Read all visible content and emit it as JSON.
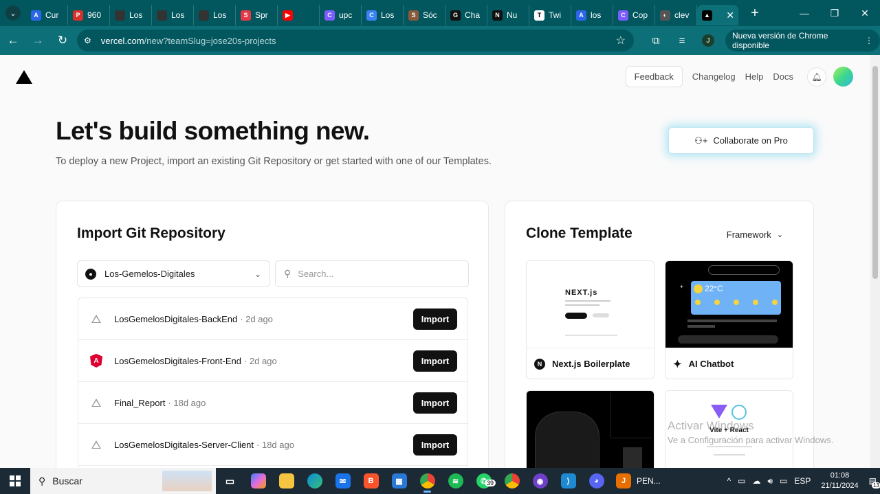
{
  "browser": {
    "tabs": [
      {
        "label": "Cur",
        "icon": "A",
        "color": "#2b66e8"
      },
      {
        "label": "960",
        "icon": "P",
        "color": "#d9302c"
      },
      {
        "label": "Los",
        "icon": "",
        "color": "#333333"
      },
      {
        "label": "Los",
        "icon": "",
        "color": "#333333"
      },
      {
        "label": "Los",
        "icon": "",
        "color": "#333333"
      },
      {
        "label": "Spr",
        "icon": "S",
        "color": "#e63946"
      },
      {
        "label": "",
        "icon": "▶",
        "color": "#ff0000"
      },
      {
        "label": "upc",
        "icon": "C",
        "color": "#7b5cff"
      },
      {
        "label": "Los",
        "icon": "C",
        "color": "#3b82f6"
      },
      {
        "label": "Sóc",
        "icon": "S",
        "color": "#8a5a3c"
      },
      {
        "label": "Cha",
        "icon": "G",
        "color": "#111111"
      },
      {
        "label": "Nu",
        "icon": "N",
        "color": "#111111"
      },
      {
        "label": "Twi",
        "icon": "T",
        "color": "#ffffff"
      },
      {
        "label": "los",
        "icon": "A",
        "color": "#2b66e8"
      },
      {
        "label": "Cop",
        "icon": "C",
        "color": "#7b5cff"
      },
      {
        "label": "clev",
        "icon": "◐",
        "color": "#555555"
      }
    ],
    "active_tab_close": "✕",
    "new_tab": "+",
    "url_host": "vercel.com",
    "url_path": "/new?teamSlug=jose20s-projects",
    "profile_initial": "J",
    "update_label": "Nueva versión de Chrome disponible"
  },
  "header": {
    "feedback": "Feedback",
    "changelog": "Changelog",
    "help": "Help",
    "docs": "Docs"
  },
  "hero": {
    "title": "Let's build something new.",
    "subtitle": "To deploy a new Project, import an existing Git Repository or get started with one of our Templates.",
    "collab_button": "Collaborate on Pro"
  },
  "import": {
    "title": "Import Git Repository",
    "account": "Los-Gemelos-Digitales",
    "search_placeholder": "Search...",
    "import_label": "Import",
    "repos": [
      {
        "name": "LosGemelosDigitales-BackEnd",
        "age": "· 2d ago",
        "icon": "triangle"
      },
      {
        "name": "LosGemelosDigitales-Front-End",
        "age": "· 2d ago",
        "icon": "angular"
      },
      {
        "name": "Final_Report",
        "age": "· 18d ago",
        "icon": "triangle"
      },
      {
        "name": "LosGemelosDigitales-Server-Client",
        "age": "· 18d ago",
        "icon": "triangle"
      }
    ]
  },
  "templates": {
    "title": "Clone Template",
    "filter": "Framework",
    "items": [
      {
        "name": "Next.js Boilerplate",
        "icon": "N"
      },
      {
        "name": "AI Chatbot",
        "icon": "✦"
      }
    ],
    "nextjs_logo": "NEXT.js",
    "weather_temp": "22°C",
    "vite_title": "Vite + React"
  },
  "watermark": {
    "line1": "Activar Windows",
    "line2": "Ve a Configuración para activar Windows."
  },
  "taskbar": {
    "search_label": "Buscar",
    "app_label": "PEN...",
    "lang": "ESP",
    "time": "01:08",
    "date": "21/11/2024",
    "whatsapp_badge": "39",
    "notif_count": "13"
  }
}
